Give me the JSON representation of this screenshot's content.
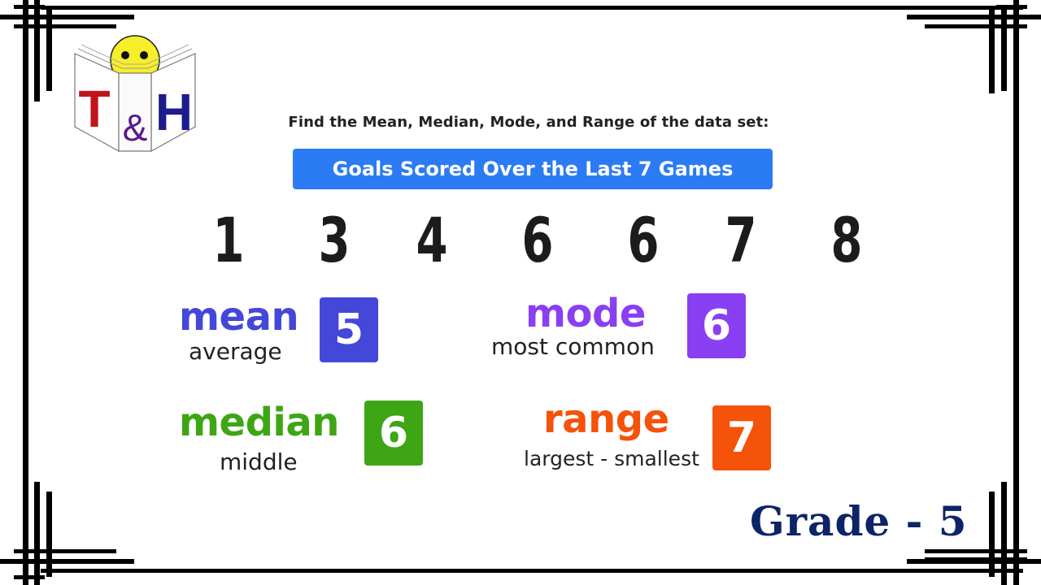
{
  "logo": {
    "letters": [
      "T",
      "&",
      "H"
    ],
    "colors": {
      "t": "#c0141c",
      "amp": "#5a1a8c",
      "h": "#1c1c8c",
      "face": "#f7ee2a"
    }
  },
  "prompt": "Find the Mean, Median, Mode, and Range of the data set:",
  "dataset_title": "Goals Scored Over the Last 7 Games",
  "dataset_values": [
    "1",
    "3",
    "4",
    "6",
    "6",
    "7",
    "8"
  ],
  "stats": {
    "mean": {
      "name": "mean",
      "desc": "average",
      "value": "5",
      "color": "#4447d8"
    },
    "mode": {
      "name": "mode",
      "desc": "most common",
      "value": "6",
      "color": "#8a3ff3"
    },
    "median": {
      "name": "median",
      "desc": "middle",
      "value": "6",
      "color": "#3ea615"
    },
    "range": {
      "name": "range",
      "desc": "largest - smallest",
      "value": "7",
      "color": "#f5520a"
    }
  },
  "grade_label": "Grade - 5",
  "colors": {
    "banner": "#2b7bf5",
    "grade": "#0d2466"
  }
}
